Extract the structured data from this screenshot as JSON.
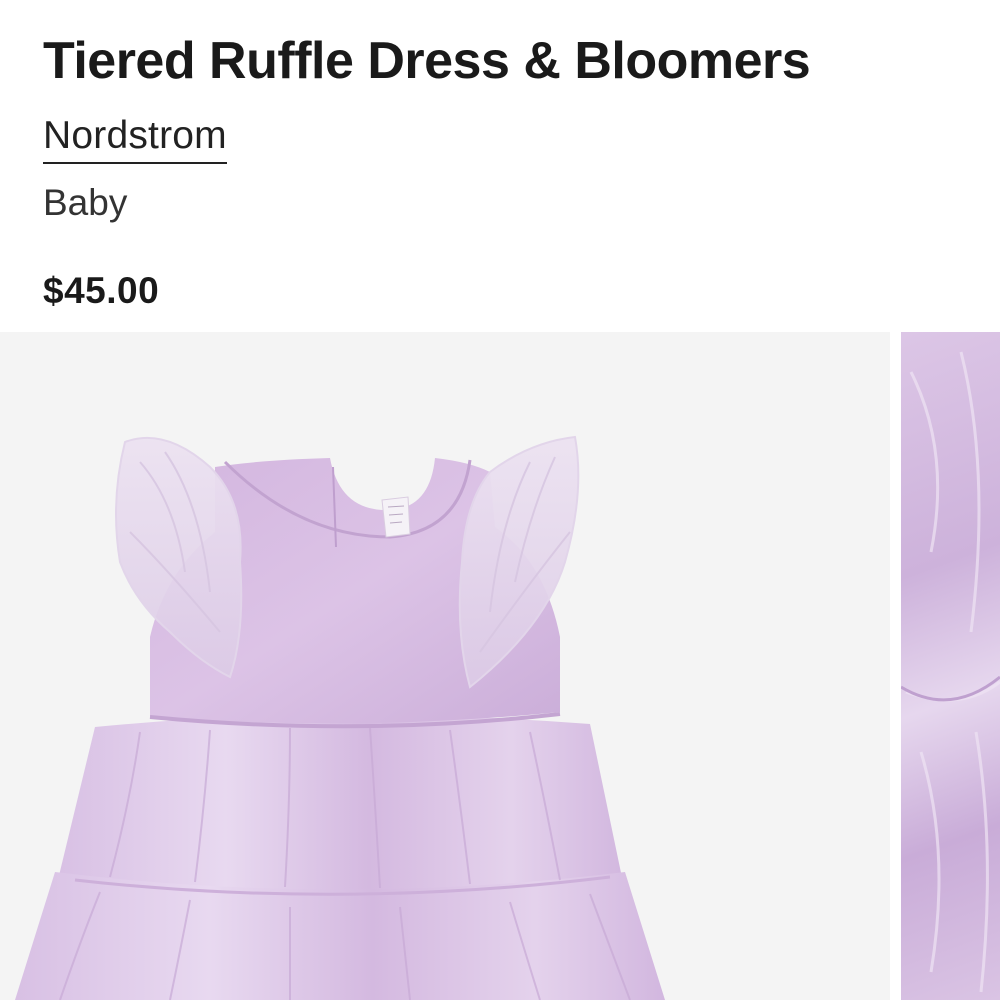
{
  "product": {
    "title": "Tiered Ruffle Dress & Bloomers",
    "brand": "Nordstrom",
    "category": "Baby",
    "price": "$45.00"
  },
  "gallery": {
    "images": [
      {
        "alt": "Lavender tiered ruffle dress, front view",
        "icon": "product-photo"
      },
      {
        "alt": "Close-up of shimmering lavender fabric",
        "icon": "product-photo"
      }
    ]
  },
  "colors": {
    "text": "#1a1a1a",
    "image_background": "#f4f4f4",
    "dress_lavender": "#d7bfe2"
  }
}
